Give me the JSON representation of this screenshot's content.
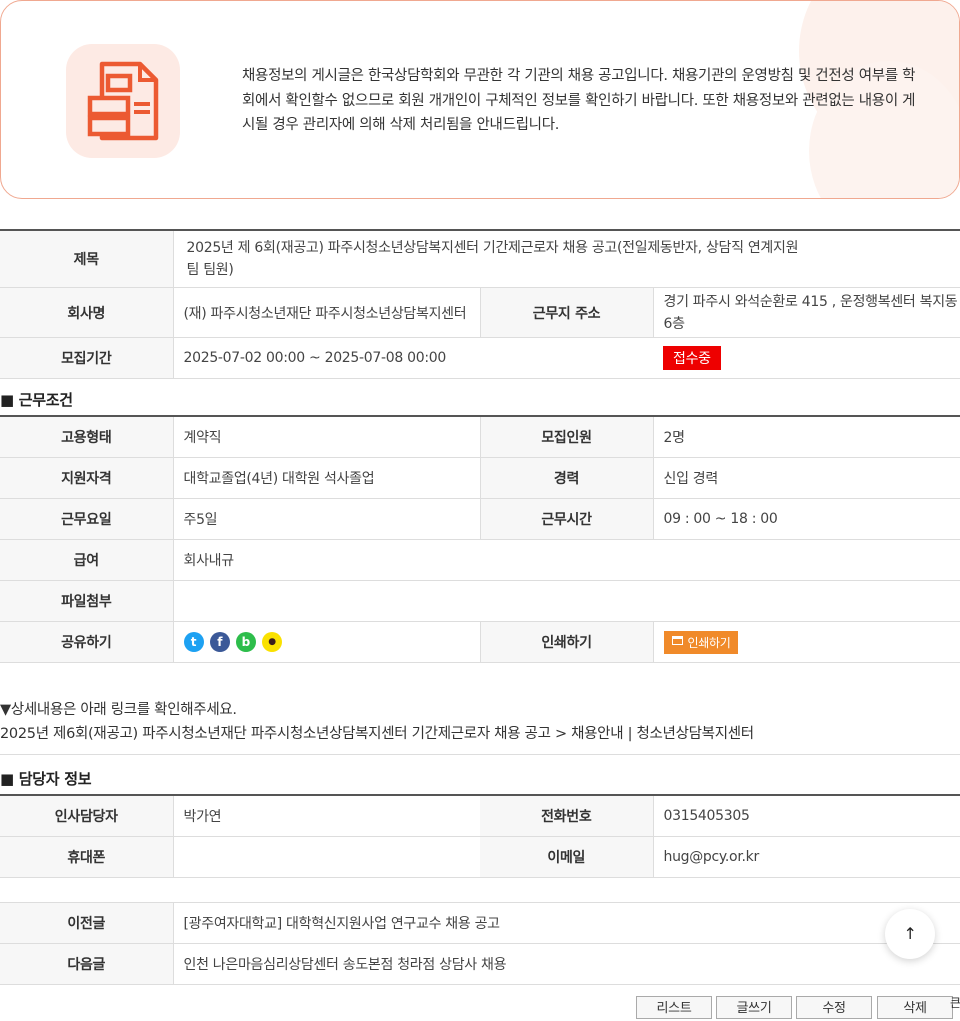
{
  "notice": {
    "text": "채용정보의 게시글은 한국상담학회와 무관한 각 기관의 채용 공고입니다. 채용기관의 운영방침 및 건전성 여부를 학회에서 확인할수 없으므로 회원 개개인이 구체적인 정보를 확인하기 바랍니다. 또한 채용정보와 관련없는 내용이 게시될 경우 관리자에 의해 삭제 처리됨을 안내드립니다.",
    "icon": "document-icon"
  },
  "post": {
    "title_label": "제목",
    "title": "2025년 제 6회(재공고) 파주시청소년상담복지센터 기간제근로자 채용 공고(전일제동반자, 상담직 연계지원팀 팀원)",
    "company_label": "회사명",
    "company": "(재) 파주시청소년재단 파주시청소년상담복지센터",
    "address_label": "근무지 주소",
    "address": "경기 파주시 와석순환로 415 , 운정행복센터 복지동 6층",
    "period_label": "모집기간",
    "period": "2025-07-02 00:00 ~ 2025-07-08 00:00",
    "status": "접수중"
  },
  "conditions": {
    "section_title": "■ 근무조건",
    "employment_type_label": "고용형태",
    "employment_type": "계약직",
    "headcount_label": "모집인원",
    "headcount": "2명",
    "qualification_label": "지원자격",
    "qualification": "대학교졸업(4년) 대학원 석사졸업",
    "career_label": "경력",
    "career": "신입 경력",
    "work_days_label": "근무요일",
    "work_days": "주5일",
    "work_hours_label": "근무시간",
    "work_hours": "09 : 00 ~ 18 : 00",
    "salary_label": "급여",
    "salary": "회사내규",
    "attachment_label": "파일첨부",
    "attachment": "",
    "share_label": "공유하기",
    "share_icons": [
      "twitter-icon",
      "facebook-icon",
      "band-icon",
      "kakaotalk-icon"
    ],
    "print_label": "인쇄하기",
    "print_button": "인쇄하기"
  },
  "detail": {
    "line1": "▼상세내용은 아래 링크를 확인해주세요.",
    "line2": "2025년 제6회(재공고) 파주시청소년재단 파주시청소년상담복지센터 기간제근로자 채용 공고 > 채용안내 | 청소년상담복지센터"
  },
  "contact": {
    "section_title": "■ 담당자 정보",
    "manager_label": "인사담당자",
    "manager": "박가연",
    "phone_label": "전화번호",
    "phone": "0315405305",
    "mobile_label": "휴대폰",
    "mobile": "",
    "email_label": "이메일",
    "email": "hug@pcy.or.kr"
  },
  "nav": {
    "prev_label": "이전글",
    "prev": "[광주여자대학교] 대학혁신지원사업 연구교수 채용 공고",
    "next_label": "다음글",
    "next": "인천 나은마음심리상담센터 송도본점 청라점 상담사 채용"
  },
  "buttons": {
    "list": "리스트",
    "write": "글쓰기",
    "edit": "수정",
    "delete": "삭제"
  },
  "scroll_top": "↑",
  "edge_text": "큰"
}
